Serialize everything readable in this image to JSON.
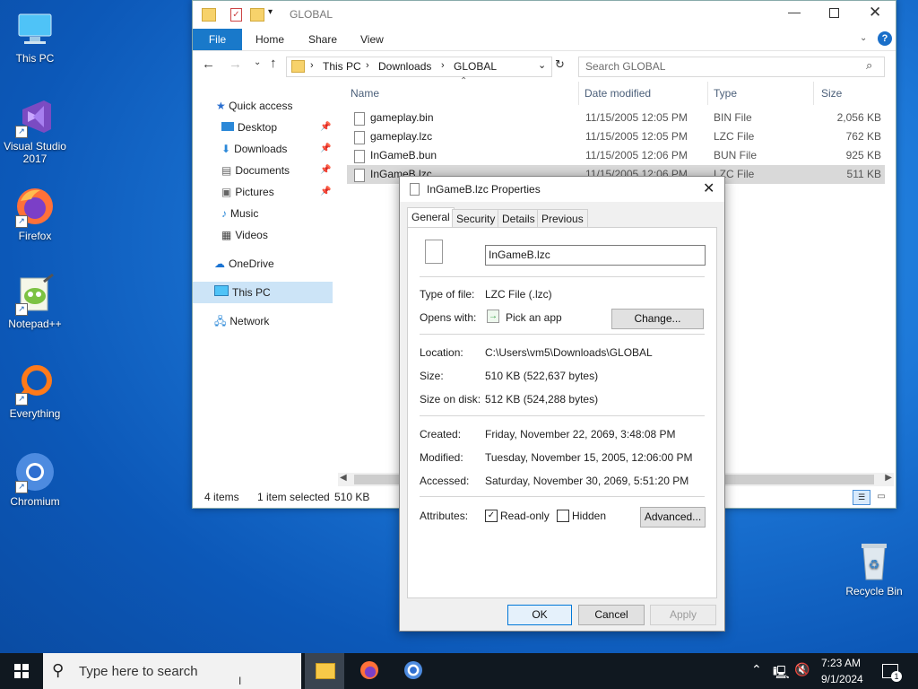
{
  "desktop": {
    "icons": [
      {
        "label": "This PC"
      },
      {
        "label": "Visual Studio 2017"
      },
      {
        "label": "Firefox"
      },
      {
        "label": "Notepad++"
      },
      {
        "label": "Everything"
      },
      {
        "label": "Chromium"
      },
      {
        "label": "Recycle Bin"
      }
    ]
  },
  "explorer": {
    "title": "GLOBAL",
    "ribbon": {
      "file": "File",
      "home": "Home",
      "share": "Share",
      "view": "View"
    },
    "breadcrumb": [
      "This PC",
      "Downloads",
      "GLOBAL"
    ],
    "search_placeholder": "Search GLOBAL",
    "nav": {
      "quick_access": "Quick access",
      "items": [
        "Desktop",
        "Downloads",
        "Documents",
        "Pictures",
        "Music",
        "Videos"
      ],
      "onedrive": "OneDrive",
      "this_pc": "This PC",
      "network": "Network"
    },
    "columns": {
      "name": "Name",
      "date": "Date modified",
      "type": "Type",
      "size": "Size"
    },
    "files": [
      {
        "name": "gameplay.bin",
        "date": "11/15/2005 12:05 PM",
        "type": "BIN File",
        "size": "2,056 KB"
      },
      {
        "name": "gameplay.lzc",
        "date": "11/15/2005 12:05 PM",
        "type": "LZC File",
        "size": "762 KB"
      },
      {
        "name": "InGameB.bun",
        "date": "11/15/2005 12:06 PM",
        "type": "BUN File",
        "size": "925 KB"
      },
      {
        "name": "InGameB.lzc",
        "date": "11/15/2005 12:06 PM",
        "type": "LZC File",
        "size": "511 KB"
      }
    ],
    "status": {
      "count": "4 items",
      "selected": "1 item selected",
      "size": "510 KB"
    }
  },
  "props": {
    "title": "InGameB.lzc Properties",
    "tabs": [
      "General",
      "Security",
      "Details",
      "Previous Versions"
    ],
    "filename": "InGameB.lzc",
    "type_label": "Type of file:",
    "type_value": "LZC File (.lzc)",
    "opens_label": "Opens with:",
    "opens_value": "Pick an app",
    "change_btn": "Change...",
    "location_label": "Location:",
    "location_value": "C:\\Users\\vm5\\Downloads\\GLOBAL",
    "size_label": "Size:",
    "size_value": "510 KB (522,637 bytes)",
    "disk_label": "Size on disk:",
    "disk_value": "512 KB (524,288 bytes)",
    "created_label": "Created:",
    "created_value": "Friday, November 22, 2069, 3:48:08 PM",
    "modified_label": "Modified:",
    "modified_value": "Tuesday, November 15, 2005, 12:06:00 PM",
    "accessed_label": "Accessed:",
    "accessed_value": "Saturday, November 30, 2069, 5:51:20 PM",
    "attributes_label": "Attributes:",
    "readonly": "Read-only",
    "hidden": "Hidden",
    "advanced_btn": "Advanced...",
    "ok": "OK",
    "cancel": "Cancel",
    "apply": "Apply"
  },
  "taskbar": {
    "search_placeholder": "Type here to search",
    "time": "7:23 AM",
    "date": "9/1/2024",
    "notifications": "1"
  }
}
